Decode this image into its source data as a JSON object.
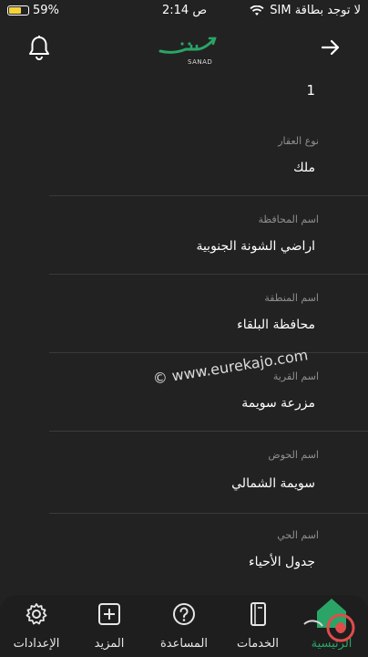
{
  "status_bar": {
    "carrier": "لا توجد بطاقة SIM",
    "time": "2:14 ص",
    "battery": "59%",
    "battery_fraction": 0.59
  },
  "header": {
    "logo_text": "SANAD",
    "bell_icon": "bell-icon",
    "back_icon": "arrow-right-icon"
  },
  "content": {
    "first_value": "1",
    "fields": [
      {
        "label": "نوع العقار",
        "value": "ملك"
      },
      {
        "label": "اسم المحافظة",
        "value": "اراضي الشونة الجنوبية"
      },
      {
        "label": "اسم المنطقة",
        "value": "محافظة البلقاء"
      },
      {
        "label": "اسم القرية",
        "value": "مزرعة سويمة"
      },
      {
        "label": "اسم الحوض",
        "value": "سويمة الشمالي"
      },
      {
        "label": "اسم الحي",
        "value": "جدول الأحياء"
      }
    ]
  },
  "watermark": "© www.eurekajo.com",
  "tabs": [
    {
      "label": "الإعدادات",
      "icon": "gear-icon"
    },
    {
      "label": "المزيد",
      "icon": "plus-square-icon"
    },
    {
      "label": "المساعدة",
      "icon": "question-circle-icon"
    },
    {
      "label": "الخدمات",
      "icon": "document-icon"
    },
    {
      "label": "الرئيسية",
      "icon": "home-icon"
    }
  ],
  "colors": {
    "background": "#222222",
    "accent": "#2aa567",
    "battery": "#f6d23a"
  }
}
